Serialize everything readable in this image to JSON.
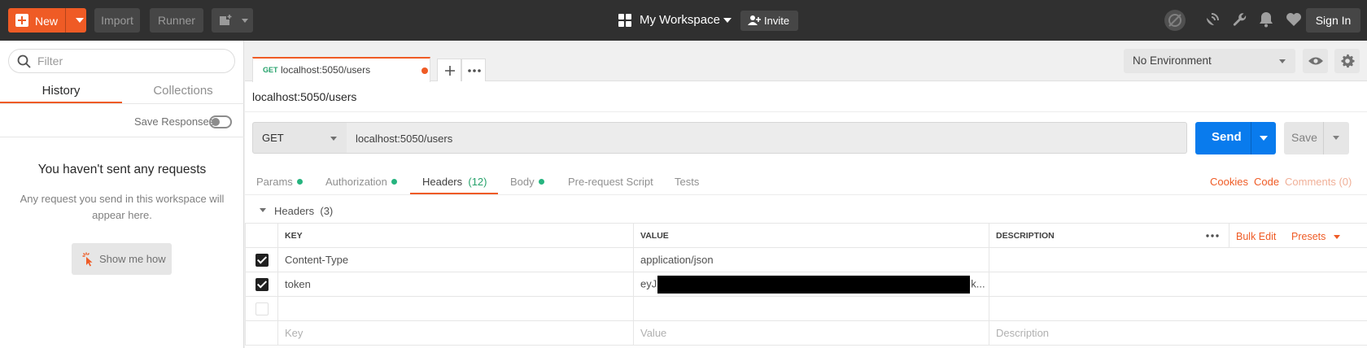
{
  "topbar": {
    "new_label": "New",
    "import_label": "Import",
    "runner_label": "Runner",
    "workspace_title": "My Workspace",
    "invite_label": "Invite",
    "signin_label": "Sign In"
  },
  "sidebar": {
    "filter_placeholder": "Filter",
    "tabs": [
      {
        "label": "History",
        "active": true
      },
      {
        "label": "Collections",
        "active": false
      }
    ],
    "save_responses_label": "Save Responses",
    "save_responses_on": false,
    "empty_title": "You haven't sent any requests",
    "empty_desc": "Any request you send in this workspace will appear here.",
    "show_me_label": "Show me how"
  },
  "request_tab": {
    "method": "GET",
    "url": "localhost:5050/users",
    "unsaved": true
  },
  "environment": {
    "selected": "No Environment"
  },
  "request": {
    "name": "localhost:5050/users",
    "method": "GET",
    "url": "localhost:5050/users",
    "send_label": "Send",
    "save_label": "Save"
  },
  "request_tabs": [
    {
      "label": "Params",
      "dot": true
    },
    {
      "label": "Authorization",
      "dot": true
    },
    {
      "label": "Headers",
      "count": "(12)",
      "active": true
    },
    {
      "label": "Body",
      "dot": true
    },
    {
      "label": "Pre-request Script"
    },
    {
      "label": "Tests"
    }
  ],
  "right_links": {
    "cookies": "Cookies",
    "code": "Code",
    "comments": "Comments (0)"
  },
  "headers_section": {
    "title": "Headers",
    "count": "(3)",
    "columns": {
      "key": "KEY",
      "value": "VALUE",
      "description": "DESCRIPTION"
    },
    "bulk_edit": "Bulk Edit",
    "presets": "Presets",
    "rows": [
      {
        "checked": true,
        "key": "Content-Type",
        "value": "application/json",
        "description": ""
      },
      {
        "checked": true,
        "key": "token",
        "value_prefix": "eyJ",
        "value_suffix": "k...",
        "redacted": true,
        "description": ""
      }
    ],
    "placeholders": {
      "key": "Key",
      "value": "Value",
      "description": "Description"
    }
  },
  "colors": {
    "accent": "#ef5b25",
    "send_blue": "#097bed",
    "topbar": "#303030",
    "status_green": "#26b47f"
  }
}
